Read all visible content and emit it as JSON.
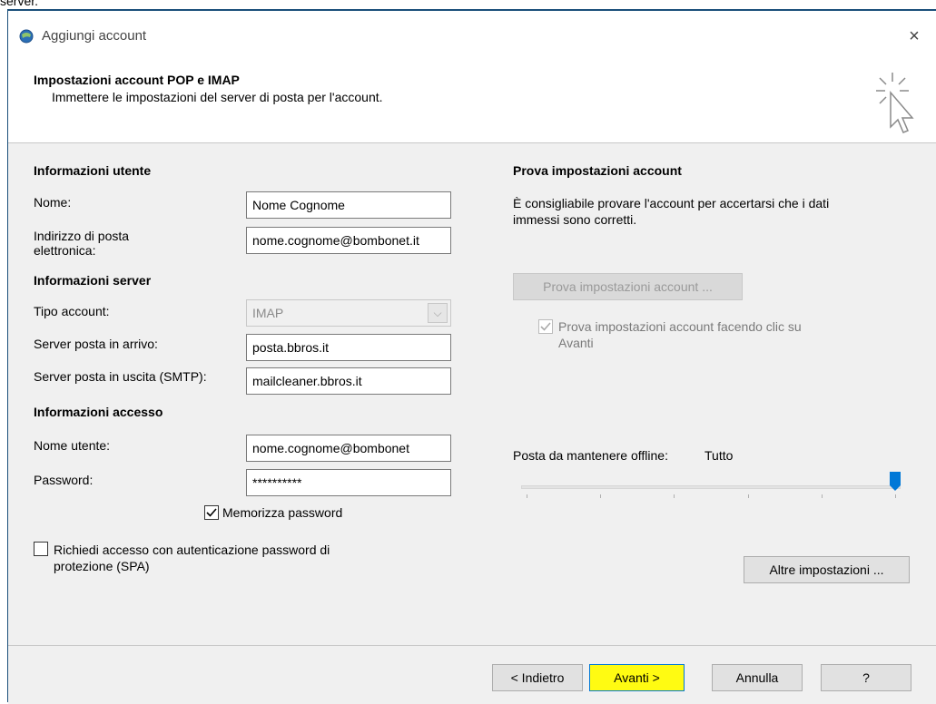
{
  "fragment_text": "server.",
  "window": {
    "title": "Aggiungi account",
    "close_glyph": "×"
  },
  "header": {
    "title": "Impostazioni account POP e IMAP",
    "subtitle": "Immettere le impostazioni del server di posta per l'account."
  },
  "user_info": {
    "section": "Informazioni utente",
    "name_label": "Nome:",
    "name_value": "Nome Cognome",
    "email_label_line1": "Indirizzo di posta",
    "email_label_line2": "elettronica:",
    "email_value": "nome.cognome@bombonet.it"
  },
  "server_info": {
    "section": "Informazioni server",
    "account_type_label": "Tipo account:",
    "account_type_value": "IMAP",
    "incoming_label": "Server posta in arrivo:",
    "incoming_value": "posta.bbros.it",
    "outgoing_label": "Server posta in uscita (SMTP):",
    "outgoing_value": "mailcleaner.bbros.it"
  },
  "login_info": {
    "section": "Informazioni accesso",
    "username_label": "Nome utente:",
    "username_value": "nome.cognome@bombonet",
    "password_label": "Password:",
    "password_value": "**********",
    "remember_label": "Memorizza password",
    "remember_checked": true,
    "spa_label_line1": "Richiedi accesso con autenticazione password di",
    "spa_label_line2": "protezione (SPA)",
    "spa_checked": false
  },
  "test": {
    "section": "Prova impostazioni account",
    "desc_line1": "È consigliabile provare l'account per accertarsi che i dati",
    "desc_line2": "immessi sono corretti.",
    "test_button": "Prova impostazioni account ...",
    "auto_test_line1": "Prova impostazioni account facendo clic su",
    "auto_test_line2": "Avanti",
    "auto_test_checked": true
  },
  "offline": {
    "label": "Posta da mantenere offline:",
    "value": "Tutto",
    "slider_level": 1.0
  },
  "more_settings_button": "Altre impostazioni ...",
  "footer": {
    "back": "< Indietro",
    "next": "Avanti >",
    "cancel": "Annulla",
    "help": "?"
  },
  "colors": {
    "highlight": "#fffb12",
    "accent": "#0078d7"
  }
}
